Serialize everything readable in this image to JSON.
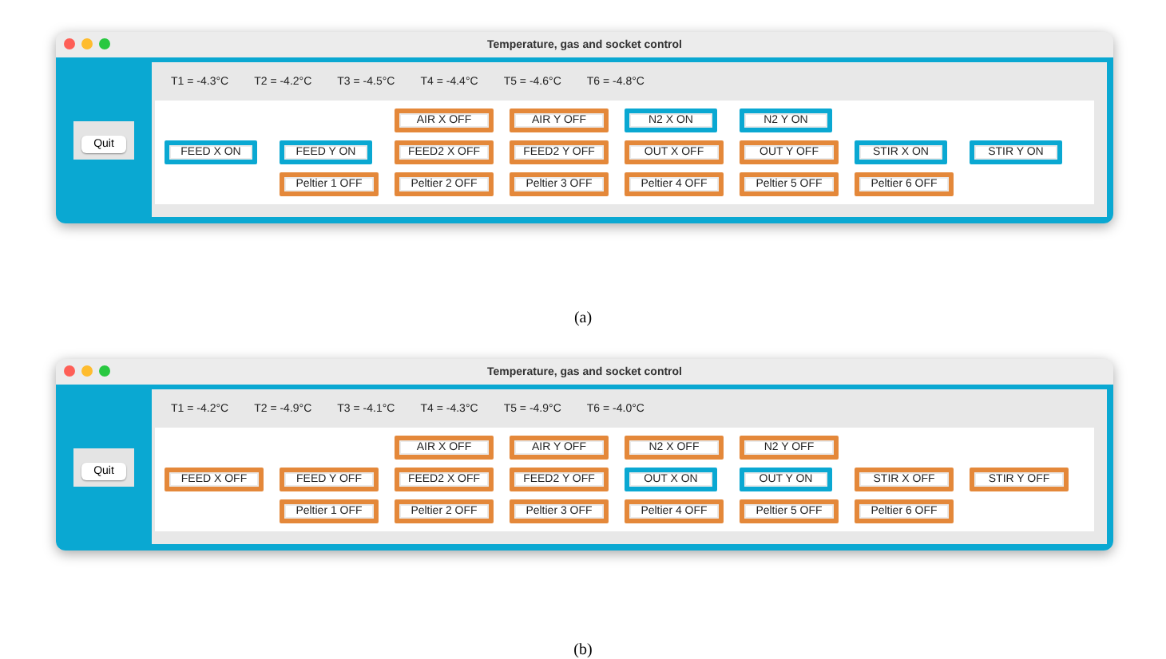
{
  "figures": [
    {
      "window": {
        "title": "Temperature, gas and socket control"
      },
      "quit": "Quit",
      "temperatures": [
        "T1 = -4.3°C",
        "T2 = -4.2°C",
        "T3 = -4.5°C",
        "T4 = -4.4°C",
        "T5 = -4.6°C",
        "T6 = -4.8°C"
      ],
      "rows": [
        [
          null,
          null,
          {
            "label": "AIR X OFF",
            "on": false
          },
          {
            "label": "AIR Y OFF",
            "on": false
          },
          {
            "label": "N2 X ON",
            "on": true
          },
          {
            "label": "N2 Y ON",
            "on": true
          },
          null,
          null
        ],
        [
          {
            "label": "FEED X ON",
            "on": true
          },
          {
            "label": "FEED Y ON",
            "on": true
          },
          {
            "label": "FEED2 X OFF",
            "on": false
          },
          {
            "label": "FEED2 Y OFF",
            "on": false
          },
          {
            "label": "OUT X OFF",
            "on": false
          },
          {
            "label": "OUT Y OFF",
            "on": false
          },
          {
            "label": "STIR X ON",
            "on": true
          },
          {
            "label": "STIR Y ON",
            "on": true
          }
        ],
        [
          null,
          {
            "label": "Peltier 1 OFF",
            "on": false
          },
          {
            "label": "Peltier 2 OFF",
            "on": false
          },
          {
            "label": "Peltier 3 OFF",
            "on": false
          },
          {
            "label": "Peltier 4 OFF",
            "on": false
          },
          {
            "label": "Peltier 5 OFF",
            "on": false
          },
          {
            "label": "Peltier 6 OFF",
            "on": false
          },
          null
        ]
      ],
      "caption": "(a)"
    },
    {
      "window": {
        "title": "Temperature, gas and socket control"
      },
      "quit": "Quit",
      "temperatures": [
        "T1 = -4.2°C",
        "T2 = -4.9°C",
        "T3 = -4.1°C",
        "T4 = -4.3°C",
        "T5 = -4.9°C",
        "T6 = -4.0°C"
      ],
      "rows": [
        [
          null,
          null,
          {
            "label": "AIR X OFF",
            "on": false
          },
          {
            "label": "AIR Y OFF",
            "on": false
          },
          {
            "label": "N2 X OFF",
            "on": false
          },
          {
            "label": "N2 Y OFF",
            "on": false
          },
          null,
          null
        ],
        [
          {
            "label": "FEED X OFF",
            "on": false
          },
          {
            "label": "FEED Y OFF",
            "on": false
          },
          {
            "label": "FEED2 X OFF",
            "on": false
          },
          {
            "label": "FEED2 Y OFF",
            "on": false
          },
          {
            "label": "OUT X ON",
            "on": true
          },
          {
            "label": "OUT Y ON",
            "on": true
          },
          {
            "label": "STIR X OFF",
            "on": false
          },
          {
            "label": "STIR Y OFF",
            "on": false
          }
        ],
        [
          null,
          {
            "label": "Peltier 1 OFF",
            "on": false
          },
          {
            "label": "Peltier 2 OFF",
            "on": false
          },
          {
            "label": "Peltier 3 OFF",
            "on": false
          },
          {
            "label": "Peltier 4 OFF",
            "on": false
          },
          {
            "label": "Peltier 5 OFF",
            "on": false
          },
          {
            "label": "Peltier 6 OFF",
            "on": false
          },
          null
        ]
      ],
      "caption": "(b)"
    }
  ]
}
